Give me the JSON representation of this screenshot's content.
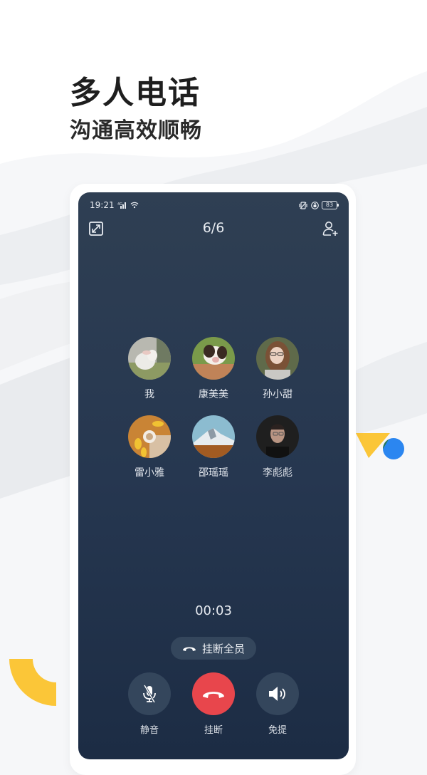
{
  "promo": {
    "headline": "多人电话",
    "subline": "沟通高效顺畅"
  },
  "status_bar": {
    "time": "19:21",
    "signal_icon": "signal-icon",
    "wifi_icon": "wifi-icon",
    "vibrate_icon": "vibrate-icon",
    "lock_rotation_icon": "rotation-lock-icon",
    "battery_level": "83"
  },
  "call": {
    "participant_count": "6/6",
    "minimize_icon": "minimize-window-icon",
    "add_participant_icon": "add-user-icon",
    "timer": "00:03",
    "hangup_all_label": "挂断全员",
    "members": [
      {
        "name": "我",
        "avatar": "lamb-photo"
      },
      {
        "name": "康美美",
        "avatar": "puppy-photo"
      },
      {
        "name": "孙小甜",
        "avatar": "woman-with-glasses-photo"
      },
      {
        "name": "雷小雅",
        "avatar": "tulips-coffee-photo"
      },
      {
        "name": "邵瑶瑶",
        "avatar": "snowy-mountain-photo"
      },
      {
        "name": "李彪彪",
        "avatar": "man-with-glasses-photo"
      }
    ],
    "controls": [
      {
        "label": "静音",
        "icon": "mic-muted-icon"
      },
      {
        "label": "挂断",
        "icon": "hang-up-icon"
      },
      {
        "label": "免提",
        "icon": "speaker-icon"
      }
    ]
  },
  "colors": {
    "screen_top": "#2f3f53",
    "screen_bottom": "#1c2c44",
    "hangup_red": "#e8464c",
    "control_bg": "#34465c",
    "accent_yellow": "#fbc638",
    "accent_blue": "#2b86f0"
  }
}
